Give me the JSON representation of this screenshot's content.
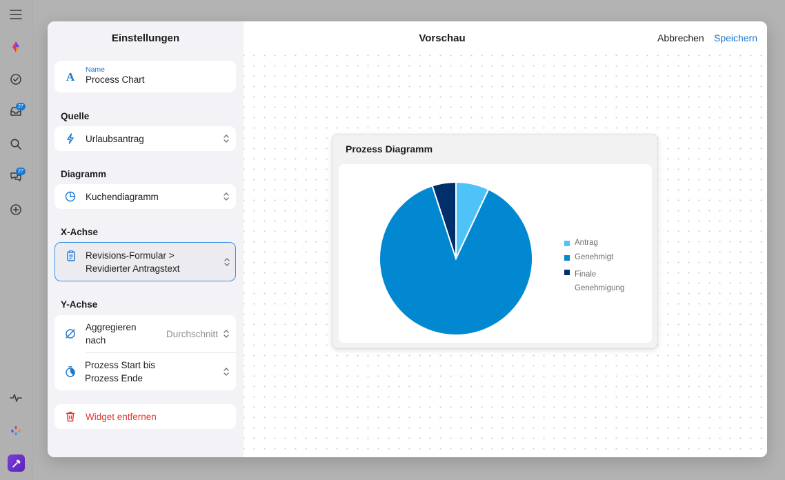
{
  "rail": {
    "badges": {
      "inbox": "27",
      "chat": "27"
    }
  },
  "settings": {
    "title": "Einstellungen",
    "name": {
      "label": "Name",
      "value": "Process Chart"
    },
    "source": {
      "section": "Quelle",
      "value": "Urlaubsantrag"
    },
    "chart": {
      "section": "Diagramm",
      "value": "Kuchendiagramm"
    },
    "x_axis": {
      "section": "X-Achse",
      "value_line1": "Revisions-Formular >",
      "value_line2": "Revidierter Antragstext"
    },
    "y_axis": {
      "section": "Y-Achse",
      "aggregate_line1": "Aggregieren",
      "aggregate_line2": "nach",
      "aggregate_value": "Durchschnitt",
      "metric_line1": "Prozess Start bis",
      "metric_line2": "Prozess Ende"
    },
    "remove_label": "Widget entfernen"
  },
  "preview": {
    "title": "Vorschau",
    "cancel_label": "Abbrechen",
    "save_label": "Speichern",
    "widget_title": "Prozess Diagramm"
  },
  "colors": {
    "accent": "#1a78d0",
    "danger": "#e0352b"
  },
  "chart_data": {
    "type": "pie",
    "categories": [
      "Antrag",
      "Genehmigt",
      "Finale Genehmigung"
    ],
    "values": [
      7,
      88,
      5
    ],
    "colors": [
      "#4fc3f7",
      "#0288d1",
      "#002f6c"
    ],
    "legend_placement": "right"
  }
}
